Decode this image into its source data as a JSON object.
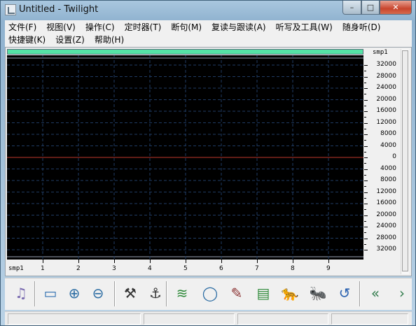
{
  "window": {
    "title": "Untitled - Twilight",
    "min_symbol": "–",
    "max_symbol": "□",
    "close_symbol": "✕"
  },
  "menu": {
    "row1": [
      "文件(F)",
      "视图(V)",
      "操作(C)",
      "定时器(T)",
      "断句(M)",
      "复读与跟读(A)",
      "听写及工具(W)",
      "随身听(D)"
    ],
    "row2": [
      "快捷键(K)",
      "设置(Z)",
      "帮助(H)"
    ]
  },
  "waveform_panel": {
    "progress_color": "#55e3a6",
    "y_unit_label": "smp1",
    "y_tick_labels": [
      "32000",
      "28000",
      "24000",
      "20000",
      "16000",
      "12000",
      "8000",
      "4000",
      "0",
      "4000",
      "8000",
      "12000",
      "16000",
      "20000",
      "24000",
      "28000",
      "32000"
    ],
    "x_unit_label": "smp1",
    "x_tick_labels": [
      "1",
      "2",
      "3",
      "4",
      "5",
      "6",
      "7",
      "8",
      "9"
    ],
    "background_color": "#000000",
    "zero_line_color": "#c0392b",
    "grid_color": "#1f3b63"
  },
  "toolbar": {
    "buttons": [
      {
        "name": "music-note-icon",
        "glyph": "♫"
      },
      {
        "name": "select-rectangle-icon",
        "glyph": "▭"
      },
      {
        "name": "zoom-in-icon",
        "glyph": "⊕"
      },
      {
        "name": "zoom-out-icon",
        "glyph": "⊖"
      },
      {
        "name": "hammer-icon",
        "glyph": "⚒"
      },
      {
        "name": "anchor-icon",
        "glyph": "⚓"
      },
      {
        "name": "waveform-tool-icon",
        "glyph": "≋"
      },
      {
        "name": "loop-icon",
        "glyph": "◯"
      },
      {
        "name": "pencil-icon",
        "glyph": "✎"
      },
      {
        "name": "text-panel-icon",
        "glyph": "▤"
      },
      {
        "name": "leopard-icon",
        "glyph": "🐆"
      },
      {
        "name": "ant-icon",
        "glyph": "🐜"
      },
      {
        "name": "swirl-icon",
        "glyph": "↺"
      },
      {
        "name": "rewind-icon",
        "glyph": "«"
      },
      {
        "name": "forward-icon",
        "glyph": "›"
      }
    ]
  }
}
